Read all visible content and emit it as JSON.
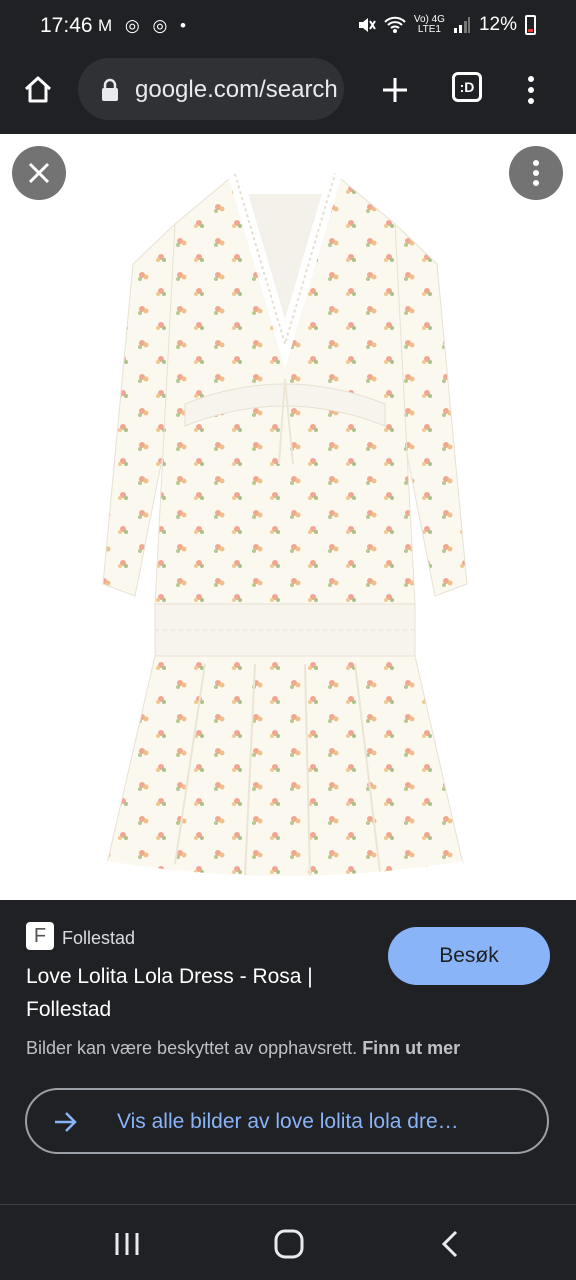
{
  "status_bar": {
    "time": "17:46",
    "notification_icons": "M ◎ ◎ •",
    "signal_label_top": "Vo) 4G",
    "signal_label_bottom": "LTE1",
    "battery": "12%"
  },
  "browser": {
    "url": "google.com/search",
    "tab_count_label": ":D"
  },
  "result": {
    "source": "Follestad",
    "favicon_letter": "F",
    "title": "Love Lolita Lola Dress - Rosa | Follestad",
    "visit_label": "Besøk",
    "copyright_text": "Bilder kan være beskyttet av opphavsrett.",
    "learn_more": "Finn ut mer",
    "view_all_label": "Vis alle bilder av love lolita lola dre…"
  },
  "colors": {
    "background": "#202124",
    "accent": "#8ab4f8",
    "image_bg": "#ffffff"
  }
}
